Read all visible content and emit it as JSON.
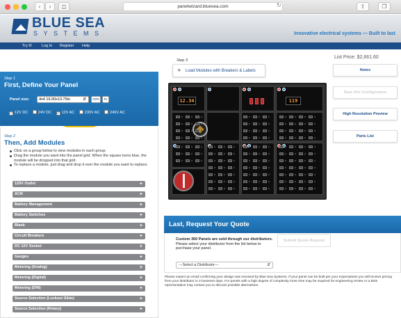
{
  "browser": {
    "url": "panelwizard.bluesea.com"
  },
  "header": {
    "logo_top": "BLUE SEA",
    "logo_bottom": "SYSTEMS",
    "tagline": "Innovative electrical systems — Built to last"
  },
  "nav": [
    "Try It!",
    "Log In",
    "Register",
    "Help"
  ],
  "step1": {
    "label": "Step 1",
    "title": "First, Define Your Panel",
    "panel_size_label": "Panel size:",
    "panel_size_value": "4x4 16.00x13.75in",
    "units": [
      "mm",
      "in"
    ],
    "voltages": [
      {
        "label": "12V DC",
        "checked": true
      },
      {
        "label": "24V DC",
        "checked": false
      },
      {
        "label": "12V AC",
        "checked": true
      },
      {
        "label": "230V AC",
        "checked": false
      },
      {
        "label": "240V AC",
        "checked": false
      }
    ]
  },
  "step2": {
    "label": "Step 2",
    "title": "Then, Add Modules",
    "instructions": [
      "Click on a group below to view modules in each group.",
      "Drag the module you want into the panel grid. When the square turns blue, the module will be dropped into that grid.",
      "To replace a module, just drag and drop it over the module you want to replace."
    ],
    "groups": [
      "120V Outlet",
      "ACR",
      "Battery Management",
      "Battery Switches",
      "Blank",
      "Circuit Breakers",
      "DC 12V Socket",
      "Gauges",
      "Metering (Analog)",
      "Metering (Digital)",
      "Metering (DIN)",
      "Source Selection (Lockout Slide)",
      "Source Selection (Rotary)"
    ]
  },
  "step3": {
    "label": "Step 3",
    "load_button": "Load Modules with Breakers & Labels",
    "meter_left": "12.34",
    "meter_right": "119"
  },
  "sidebar": {
    "list_price": "List Price: $2,661.60",
    "buttons": [
      {
        "label": "Notes",
        "disabled": false
      },
      {
        "label": "Save this Configuration",
        "disabled": true
      },
      {
        "label": "High Resolution Preview",
        "disabled": false
      },
      {
        "label": "Parts List",
        "disabled": false
      }
    ]
  },
  "quote": {
    "title": "Last, Request Your Quote",
    "bold_text": "Custom 360 Panels are sold through our distributors.",
    "text": "Please select your distributor from the list below to purchase your panel.",
    "distributor_placeholder": "---Select a Distributor---",
    "submit": "Submit Quote Request",
    "fine_print": "Please expect an email confirming your design was received by Blue Sea Systems. If your panel can be built per your expectations you will receive pricing from your distributor in 3 business days. For panels with a high degree of complexity more time may be required for engineering review or a BSS representative may contact you to discuss possible alternatives."
  }
}
